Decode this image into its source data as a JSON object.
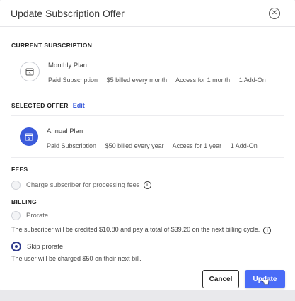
{
  "modal": {
    "title": "Update Subscription Offer"
  },
  "current_subscription": {
    "label": "CURRENT SUBSCRIPTION",
    "plan_name": "Monthly Plan",
    "details": [
      "Paid Subscription",
      "$5 billed every month",
      "Access for 1 month",
      "1 Add-On"
    ]
  },
  "selected_offer": {
    "label": "SELECTED OFFER",
    "edit_label": "Edit",
    "plan_name": "Annual Plan",
    "details": [
      "Paid Subscription",
      "$50 billed every year",
      "Access for 1 year",
      "1 Add-On"
    ]
  },
  "fees": {
    "label": "FEES",
    "option_label": "Charge subscriber for processing fees",
    "checked": false
  },
  "billing": {
    "label": "BILLING",
    "prorate_label": "Prorate",
    "prorate_helper": "The subscriber will be credited $10.80 and pay a total of $39.20 on the next billing cycle.",
    "skip_label": "Skip prorate",
    "skip_helper": "The user will be charged $50 on their next bill.",
    "selected": "skip"
  },
  "footer": {
    "cancel_label": "Cancel",
    "update_label": "Update"
  },
  "colors": {
    "accent": "#4a6cf7",
    "radio_selected": "#2f3a8c"
  },
  "icons": {
    "close": "close-icon",
    "calendar": "calendar-icon",
    "info": "info-icon"
  }
}
